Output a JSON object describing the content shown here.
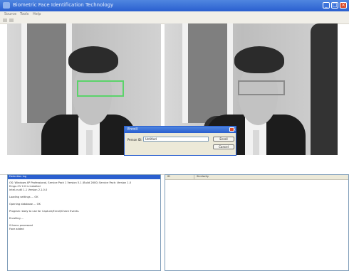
{
  "window": {
    "title": "Biometric Face Identification Technology",
    "controls": {
      "minimize": "_",
      "maximize": "□",
      "close": "×"
    }
  },
  "menu": [
    "Source",
    "Tools",
    "Help"
  ],
  "toolbar": {
    "icons": [
      "open-icon",
      "settings-icon"
    ]
  },
  "dialog": {
    "title": "Enroll",
    "field_label": "Person ID:",
    "field_value": "Untitled",
    "ok_label": "Enroll",
    "cancel_label": "Cancel",
    "close_glyph": "×"
  },
  "log": {
    "header": "Detection log",
    "lines": [
      "OS: Windows XP Professional, Service Pack 1 Version 5.1 (Build 2600) Service Pack: Version 1.0",
      "Emgu.CV 2.0 is installed",
      "Intel.cv.dll 1.1  Version 2.1.0.0",
      "",
      "Loading settings ... OK",
      "",
      "Opening database ... OK",
      "",
      "Program ready to use for Capture/Enroll/Check Events.",
      "",
      "Enrolling ...",
      "",
      "0 items processed",
      "Face added"
    ]
  },
  "list": {
    "columns": [
      "ID",
      "Similarity"
    ]
  },
  "colors": {
    "titlebar": "#2a5fcf",
    "detect_box": "#5bd36a",
    "match_box": "#8a8a8a"
  }
}
